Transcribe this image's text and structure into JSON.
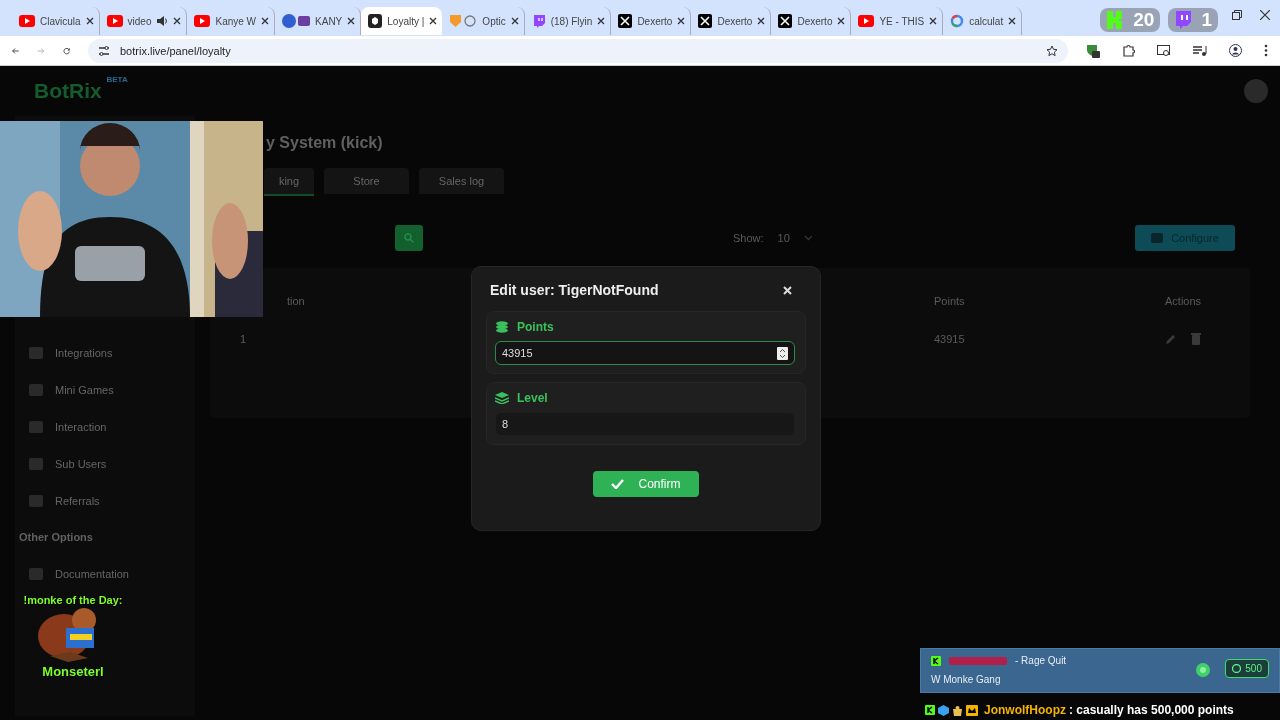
{
  "browser": {
    "tabs": [
      {
        "title": "Clavicula",
        "kind": "youtube",
        "selected": false,
        "audio": false
      },
      {
        "title": "video",
        "kind": "youtube",
        "selected": false,
        "audio": true
      },
      {
        "title": "Kanye W",
        "kind": "youtube",
        "selected": false,
        "audio": false
      },
      {
        "title": "KANY",
        "kind": "pair",
        "selected": false,
        "audio": false
      },
      {
        "title": "Loyalty |",
        "kind": "botrix",
        "selected": true,
        "audio": false
      },
      {
        "title": "Optic",
        "kind": "shield",
        "selected": false,
        "audio": false
      },
      {
        "title": "(18) Flyin",
        "kind": "twitch",
        "selected": false,
        "audio": false
      },
      {
        "title": "Dexerto",
        "kind": "x",
        "selected": false,
        "audio": false
      },
      {
        "title": "Dexerto",
        "kind": "x",
        "selected": false,
        "audio": false
      },
      {
        "title": "Dexerto",
        "kind": "x",
        "selected": false,
        "audio": false
      },
      {
        "title": "YE - THIS",
        "kind": "youtube",
        "selected": false,
        "audio": false
      },
      {
        "title": "calculat",
        "kind": "google",
        "selected": false,
        "audio": false
      }
    ],
    "counters": [
      {
        "kind": "kick",
        "count": "20"
      },
      {
        "kind": "twitch",
        "count": "1"
      }
    ],
    "url": "botrix.live/panel/loyalty"
  },
  "page": {
    "logo": "BotRix",
    "logo_badge": "BETA",
    "title": "y System (kick)",
    "tabs": [
      {
        "label": "king",
        "selected": true
      },
      {
        "label": "Store",
        "selected": false
      },
      {
        "label": "Sales log",
        "selected": false
      }
    ],
    "show_label": "Show:",
    "show_value": "10",
    "configure": "Configure",
    "columns": [
      "tion",
      "Points",
      "Actions"
    ],
    "rows": [
      {
        "cells": [
          "1",
          "43915"
        ]
      }
    ],
    "sidebar": [
      {
        "kind": "item",
        "label": "Integrations"
      },
      {
        "kind": "item",
        "label": "Mini Games"
      },
      {
        "kind": "item",
        "label": "Interaction"
      },
      {
        "kind": "item",
        "label": "Sub Users"
      },
      {
        "kind": "item",
        "label": "Referrals"
      },
      {
        "kind": "heading",
        "label": "Other Options"
      },
      {
        "kind": "item",
        "label": "Documentation"
      }
    ]
  },
  "modal": {
    "title": "Edit user: TigerNotFound",
    "fields": [
      {
        "label": "Points",
        "value": "43915",
        "focused": true
      },
      {
        "label": "Level",
        "value": "8",
        "focused": false
      }
    ],
    "confirm": "Confirm"
  },
  "overlay": {
    "monke": {
      "heading": "!monke of the Day:",
      "name": "Monseterl"
    },
    "alert": {
      "title": "- Rage Quit",
      "message": "W Monke Gang",
      "points": "500"
    },
    "chat": {
      "user": "JonwolfHoopz",
      "message": ": casually has 500,000 points"
    }
  }
}
